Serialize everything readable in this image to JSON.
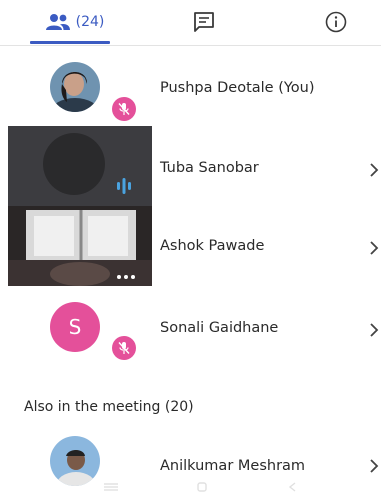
{
  "tabs": {
    "people": {
      "icon": "people-icon",
      "count_label": "(24)"
    },
    "chat": {
      "icon": "chat-icon"
    },
    "info": {
      "icon": "info-icon"
    }
  },
  "participants": [
    {
      "name": "Pushpa Deotale (You)",
      "avatar": "photo",
      "status": "muted"
    },
    {
      "name": "Tuba Sanobar",
      "avatar": "video",
      "status": "speaking"
    },
    {
      "name": "Ashok Pawade",
      "avatar": "video",
      "status": "more-options"
    },
    {
      "name": "Sonali Gaidhane",
      "avatar_initial": "S",
      "status": "muted"
    }
  ],
  "section": {
    "label": "Also in the meeting (20)"
  },
  "others": [
    {
      "name": "Anilkumar Meshram",
      "avatar": "photo"
    }
  ],
  "colors": {
    "accent": "#3b5bc2",
    "mute_badge": "#e4509a",
    "speaking": "#4aa3e0"
  }
}
